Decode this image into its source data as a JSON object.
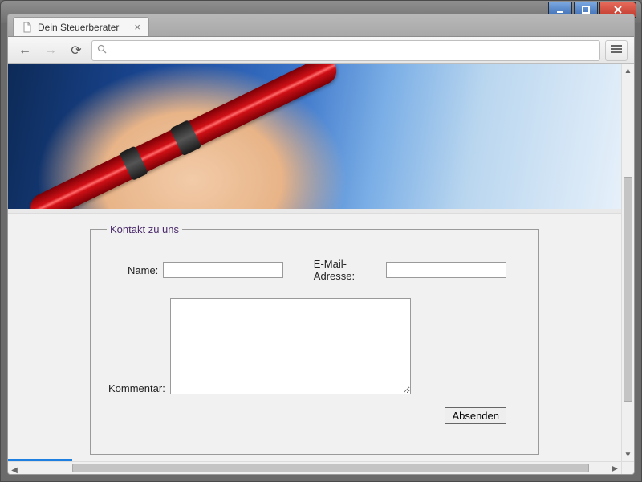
{
  "window": {
    "minimize_tooltip": "Minimize",
    "maximize_tooltip": "Maximize",
    "close_tooltip": "Close"
  },
  "browser": {
    "tab_title": "Dein Steuerberater",
    "address_value": "",
    "address_placeholder": ""
  },
  "form": {
    "legend": "Kontakt zu uns",
    "name_label": "Name:",
    "name_value": "",
    "email_label": "E-Mail-Adresse:",
    "email_value": "",
    "comment_label": "Kommentar:",
    "comment_value": "",
    "submit_label": "Absenden"
  }
}
